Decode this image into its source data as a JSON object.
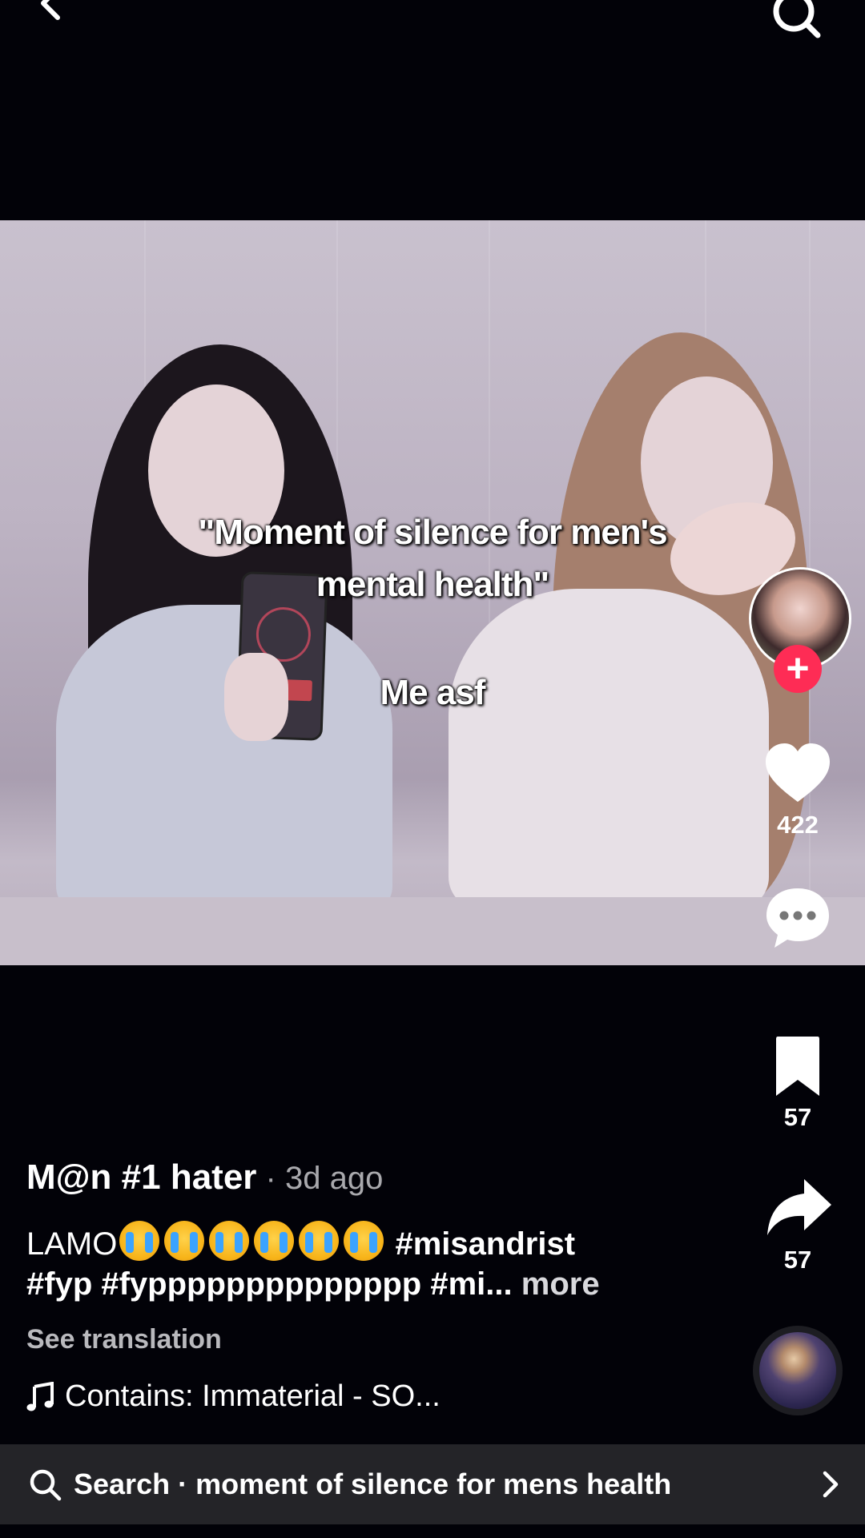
{
  "video": {
    "caption_line1": "\"Moment of silence for men's",
    "caption_line2": "mental health\"",
    "caption_line3": "Me asf"
  },
  "actions": {
    "like_count": "422",
    "save_count": "57",
    "share_count": "57"
  },
  "post": {
    "author": "M@n #1 hater",
    "time": " · 3d ago",
    "desc_text": "LAMO",
    "hashtag1": "#misandrist",
    "hashtags_line2": "#fyp #fypppppppppppppp #mi...",
    "more_label": "more",
    "see_translation": "See translation",
    "music": "Contains: Immaterial - SO..."
  },
  "search_bar": {
    "text": "Search · moment of silence for mens health"
  },
  "colors": {
    "accent": "#fe2c55",
    "background": "#020208",
    "search_bar_bg": "#242428"
  },
  "icons": [
    "back-icon",
    "search-icon",
    "plus-icon",
    "heart-icon",
    "comment-icon",
    "bookmark-icon",
    "share-icon",
    "music-note-icon",
    "chevron-right-icon"
  ]
}
